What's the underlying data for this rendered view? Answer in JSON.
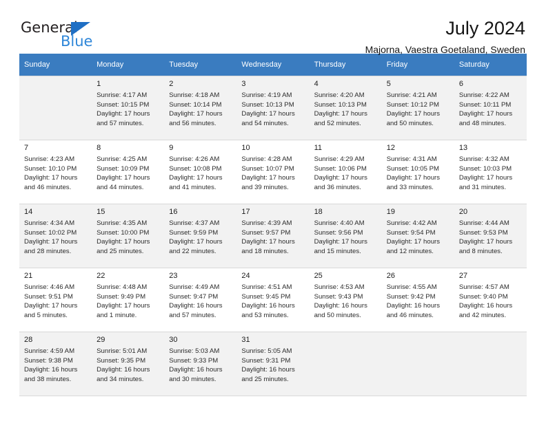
{
  "brand": {
    "name_top": "General",
    "name_bottom": "Blue",
    "triangle_color": "#1f6fc4",
    "blue_color": "#2e86d8"
  },
  "header": {
    "title": "July 2024",
    "subtitle": "Majorna, Vaestra Goetaland, Sweden"
  },
  "theme": {
    "header_row_bg": "#3a7cc0",
    "header_row_text": "#ffffff",
    "shaded_row_bg": "#f2f2f2",
    "grid_line": "#d8d8d8"
  },
  "weekdays": [
    "Sunday",
    "Monday",
    "Tuesday",
    "Wednesday",
    "Thursday",
    "Friday",
    "Saturday"
  ],
  "weeks": [
    [
      {
        "day": "",
        "sunrise": "",
        "sunset": "",
        "daylight_a": "",
        "daylight_b": ""
      },
      {
        "day": "1",
        "sunrise": "Sunrise: 4:17 AM",
        "sunset": "Sunset: 10:15 PM",
        "daylight_a": "Daylight: 17 hours",
        "daylight_b": "and 57 minutes."
      },
      {
        "day": "2",
        "sunrise": "Sunrise: 4:18 AM",
        "sunset": "Sunset: 10:14 PM",
        "daylight_a": "Daylight: 17 hours",
        "daylight_b": "and 56 minutes."
      },
      {
        "day": "3",
        "sunrise": "Sunrise: 4:19 AM",
        "sunset": "Sunset: 10:13 PM",
        "daylight_a": "Daylight: 17 hours",
        "daylight_b": "and 54 minutes."
      },
      {
        "day": "4",
        "sunrise": "Sunrise: 4:20 AM",
        "sunset": "Sunset: 10:13 PM",
        "daylight_a": "Daylight: 17 hours",
        "daylight_b": "and 52 minutes."
      },
      {
        "day": "5",
        "sunrise": "Sunrise: 4:21 AM",
        "sunset": "Sunset: 10:12 PM",
        "daylight_a": "Daylight: 17 hours",
        "daylight_b": "and 50 minutes."
      },
      {
        "day": "6",
        "sunrise": "Sunrise: 4:22 AM",
        "sunset": "Sunset: 10:11 PM",
        "daylight_a": "Daylight: 17 hours",
        "daylight_b": "and 48 minutes."
      }
    ],
    [
      {
        "day": "7",
        "sunrise": "Sunrise: 4:23 AM",
        "sunset": "Sunset: 10:10 PM",
        "daylight_a": "Daylight: 17 hours",
        "daylight_b": "and 46 minutes."
      },
      {
        "day": "8",
        "sunrise": "Sunrise: 4:25 AM",
        "sunset": "Sunset: 10:09 PM",
        "daylight_a": "Daylight: 17 hours",
        "daylight_b": "and 44 minutes."
      },
      {
        "day": "9",
        "sunrise": "Sunrise: 4:26 AM",
        "sunset": "Sunset: 10:08 PM",
        "daylight_a": "Daylight: 17 hours",
        "daylight_b": "and 41 minutes."
      },
      {
        "day": "10",
        "sunrise": "Sunrise: 4:28 AM",
        "sunset": "Sunset: 10:07 PM",
        "daylight_a": "Daylight: 17 hours",
        "daylight_b": "and 39 minutes."
      },
      {
        "day": "11",
        "sunrise": "Sunrise: 4:29 AM",
        "sunset": "Sunset: 10:06 PM",
        "daylight_a": "Daylight: 17 hours",
        "daylight_b": "and 36 minutes."
      },
      {
        "day": "12",
        "sunrise": "Sunrise: 4:31 AM",
        "sunset": "Sunset: 10:05 PM",
        "daylight_a": "Daylight: 17 hours",
        "daylight_b": "and 33 minutes."
      },
      {
        "day": "13",
        "sunrise": "Sunrise: 4:32 AM",
        "sunset": "Sunset: 10:03 PM",
        "daylight_a": "Daylight: 17 hours",
        "daylight_b": "and 31 minutes."
      }
    ],
    [
      {
        "day": "14",
        "sunrise": "Sunrise: 4:34 AM",
        "sunset": "Sunset: 10:02 PM",
        "daylight_a": "Daylight: 17 hours",
        "daylight_b": "and 28 minutes."
      },
      {
        "day": "15",
        "sunrise": "Sunrise: 4:35 AM",
        "sunset": "Sunset: 10:00 PM",
        "daylight_a": "Daylight: 17 hours",
        "daylight_b": "and 25 minutes."
      },
      {
        "day": "16",
        "sunrise": "Sunrise: 4:37 AM",
        "sunset": "Sunset: 9:59 PM",
        "daylight_a": "Daylight: 17 hours",
        "daylight_b": "and 22 minutes."
      },
      {
        "day": "17",
        "sunrise": "Sunrise: 4:39 AM",
        "sunset": "Sunset: 9:57 PM",
        "daylight_a": "Daylight: 17 hours",
        "daylight_b": "and 18 minutes."
      },
      {
        "day": "18",
        "sunrise": "Sunrise: 4:40 AM",
        "sunset": "Sunset: 9:56 PM",
        "daylight_a": "Daylight: 17 hours",
        "daylight_b": "and 15 minutes."
      },
      {
        "day": "19",
        "sunrise": "Sunrise: 4:42 AM",
        "sunset": "Sunset: 9:54 PM",
        "daylight_a": "Daylight: 17 hours",
        "daylight_b": "and 12 minutes."
      },
      {
        "day": "20",
        "sunrise": "Sunrise: 4:44 AM",
        "sunset": "Sunset: 9:53 PM",
        "daylight_a": "Daylight: 17 hours",
        "daylight_b": "and 8 minutes."
      }
    ],
    [
      {
        "day": "21",
        "sunrise": "Sunrise: 4:46 AM",
        "sunset": "Sunset: 9:51 PM",
        "daylight_a": "Daylight: 17 hours",
        "daylight_b": "and 5 minutes."
      },
      {
        "day": "22",
        "sunrise": "Sunrise: 4:48 AM",
        "sunset": "Sunset: 9:49 PM",
        "daylight_a": "Daylight: 17 hours",
        "daylight_b": "and 1 minute."
      },
      {
        "day": "23",
        "sunrise": "Sunrise: 4:49 AM",
        "sunset": "Sunset: 9:47 PM",
        "daylight_a": "Daylight: 16 hours",
        "daylight_b": "and 57 minutes."
      },
      {
        "day": "24",
        "sunrise": "Sunrise: 4:51 AM",
        "sunset": "Sunset: 9:45 PM",
        "daylight_a": "Daylight: 16 hours",
        "daylight_b": "and 53 minutes."
      },
      {
        "day": "25",
        "sunrise": "Sunrise: 4:53 AM",
        "sunset": "Sunset: 9:43 PM",
        "daylight_a": "Daylight: 16 hours",
        "daylight_b": "and 50 minutes."
      },
      {
        "day": "26",
        "sunrise": "Sunrise: 4:55 AM",
        "sunset": "Sunset: 9:42 PM",
        "daylight_a": "Daylight: 16 hours",
        "daylight_b": "and 46 minutes."
      },
      {
        "day": "27",
        "sunrise": "Sunrise: 4:57 AM",
        "sunset": "Sunset: 9:40 PM",
        "daylight_a": "Daylight: 16 hours",
        "daylight_b": "and 42 minutes."
      }
    ],
    [
      {
        "day": "28",
        "sunrise": "Sunrise: 4:59 AM",
        "sunset": "Sunset: 9:38 PM",
        "daylight_a": "Daylight: 16 hours",
        "daylight_b": "and 38 minutes."
      },
      {
        "day": "29",
        "sunrise": "Sunrise: 5:01 AM",
        "sunset": "Sunset: 9:35 PM",
        "daylight_a": "Daylight: 16 hours",
        "daylight_b": "and 34 minutes."
      },
      {
        "day": "30",
        "sunrise": "Sunrise: 5:03 AM",
        "sunset": "Sunset: 9:33 PM",
        "daylight_a": "Daylight: 16 hours",
        "daylight_b": "and 30 minutes."
      },
      {
        "day": "31",
        "sunrise": "Sunrise: 5:05 AM",
        "sunset": "Sunset: 9:31 PM",
        "daylight_a": "Daylight: 16 hours",
        "daylight_b": "and 25 minutes."
      },
      {
        "day": "",
        "sunrise": "",
        "sunset": "",
        "daylight_a": "",
        "daylight_b": ""
      },
      {
        "day": "",
        "sunrise": "",
        "sunset": "",
        "daylight_a": "",
        "daylight_b": ""
      },
      {
        "day": "",
        "sunrise": "",
        "sunset": "",
        "daylight_a": "",
        "daylight_b": ""
      }
    ]
  ]
}
